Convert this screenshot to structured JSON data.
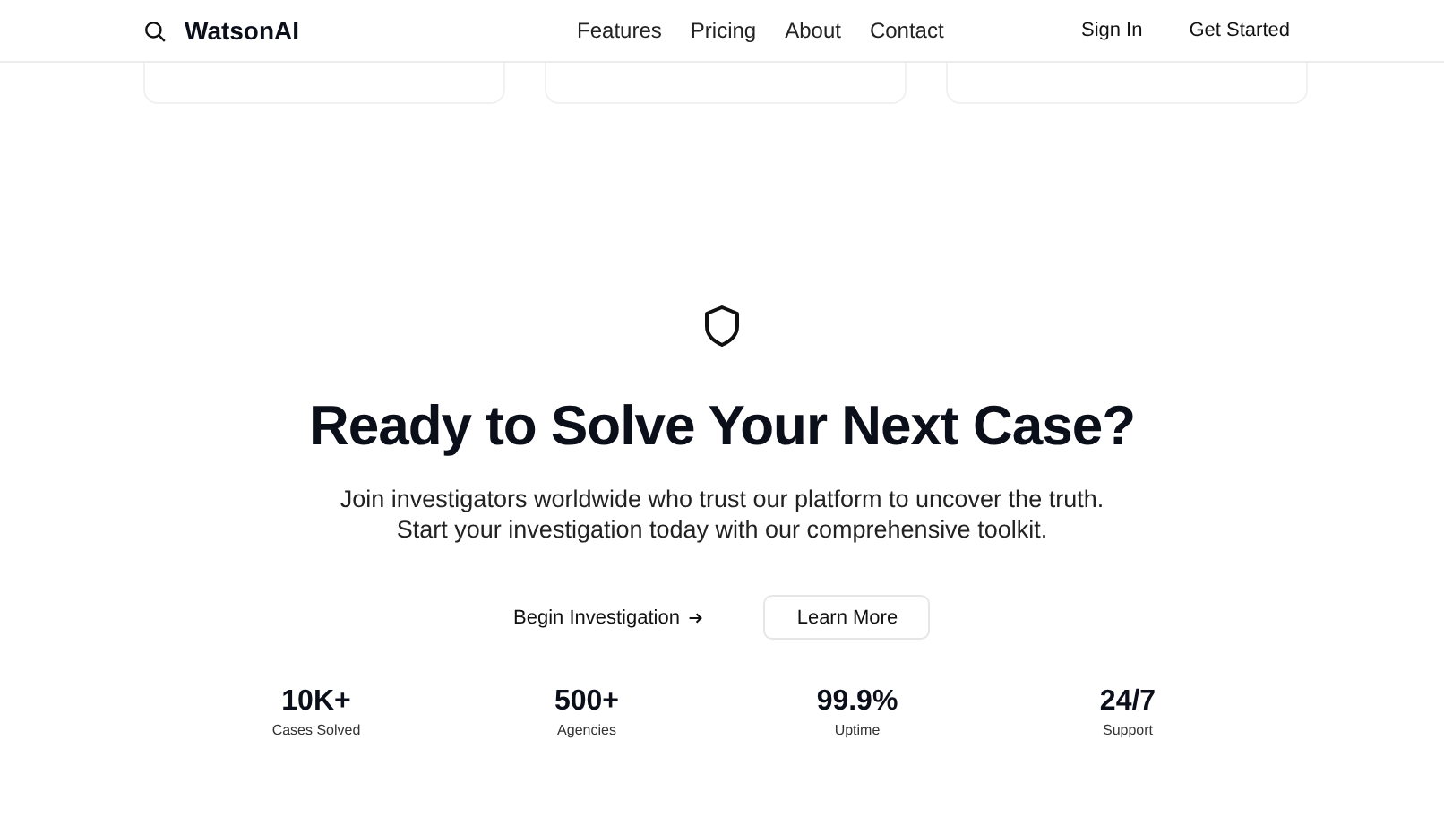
{
  "header": {
    "brand": "WatsonAI",
    "nav": [
      "Features",
      "Pricing",
      "About",
      "Contact"
    ],
    "sign_in": "Sign In",
    "get_started": "Get Started"
  },
  "cta": {
    "title": "Ready to Solve Your Next Case?",
    "lines": [
      "Join investigators worldwide who trust our platform to uncover the truth.",
      "Start your investigation today with our comprehensive toolkit."
    ],
    "primary": "Begin Investigation",
    "secondary": "Learn More"
  },
  "stats": [
    {
      "value": "10K+",
      "label": "Cases Solved"
    },
    {
      "value": "500+",
      "label": "Agencies"
    },
    {
      "value": "99.9%",
      "label": "Uptime"
    },
    {
      "value": "24/7",
      "label": "Support"
    }
  ]
}
